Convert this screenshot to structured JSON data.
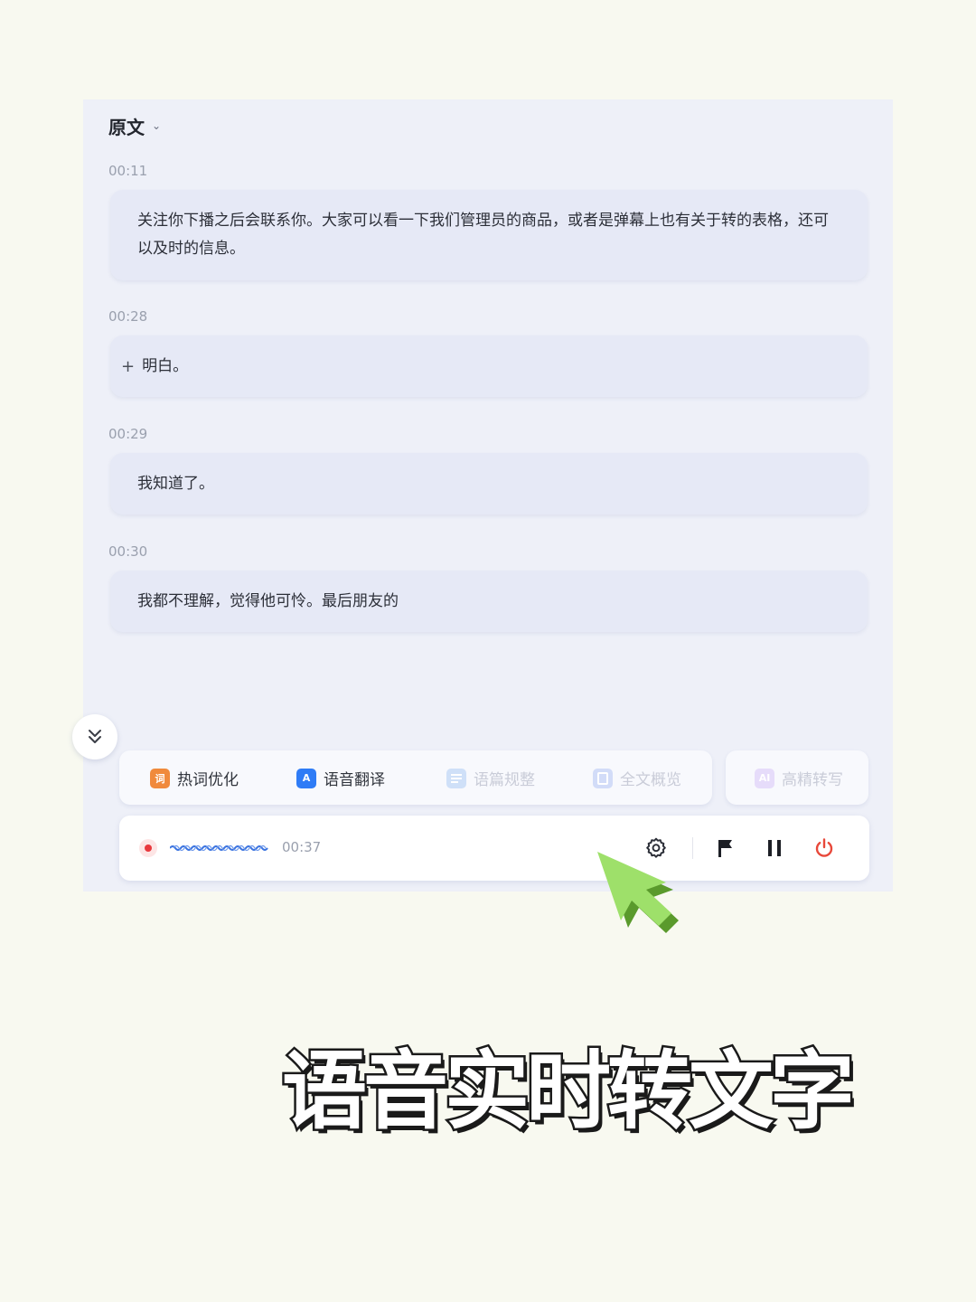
{
  "header": {
    "view_label": "原文"
  },
  "transcript": [
    {
      "time": "00:11",
      "text": "关注你下播之后会联系你。大家可以看一下我们管理员的商品，或者是弹幕上也有关于转的表格，还可以及时的信息。"
    },
    {
      "time": "00:28",
      "text": "明白。",
      "marker": "+"
    },
    {
      "time": "00:29",
      "text": "我知道了。"
    },
    {
      "time": "00:30",
      "text": "我都不理解，觉得他可怜。最后朋友的"
    }
  ],
  "tools": [
    {
      "label": "热词优化",
      "icon": "hotword-icon",
      "icon_text": "词",
      "enabled": true,
      "color": "#f08a3c"
    },
    {
      "label": "语音翻译",
      "icon": "translate-icon",
      "icon_text": "A",
      "enabled": true,
      "color": "#2f7cf6"
    },
    {
      "label": "语篇规整",
      "icon": "paragraph-icon",
      "enabled": false,
      "color": "#cfe0f8"
    },
    {
      "label": "全文概览",
      "icon": "overview-icon",
      "enabled": false,
      "color": "#d2dcf8"
    },
    {
      "label": "高精转写",
      "icon": "ai-icon",
      "icon_text": "AI",
      "enabled": false,
      "color": "#e6dcfa"
    }
  ],
  "recorder": {
    "elapsed": "00:37",
    "recording_color": "#e8383d",
    "stop_color": "#e8483a"
  },
  "caption": "语音实时转文字"
}
